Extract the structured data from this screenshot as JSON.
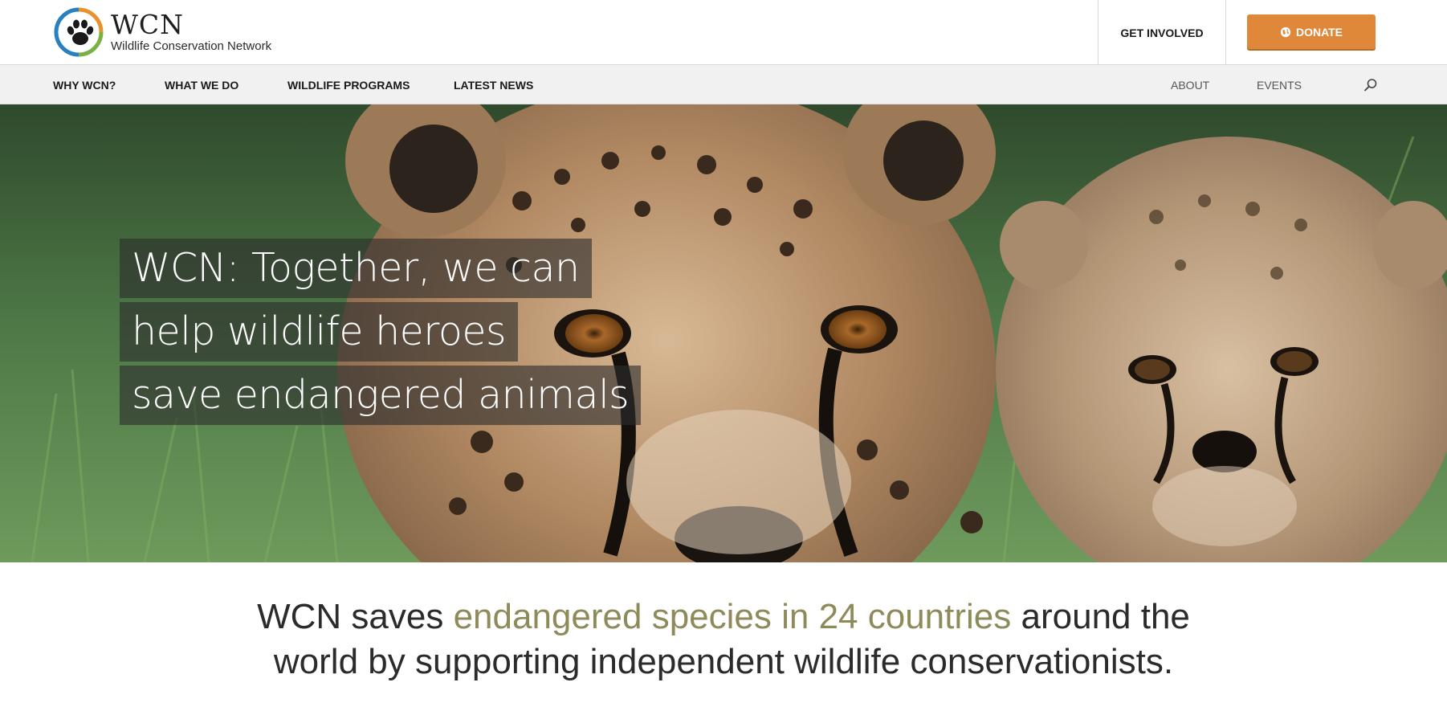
{
  "brand": {
    "name": "WCN",
    "full_name": "Wildlife Conservation Network"
  },
  "header": {
    "get_involved_label": "GET INVOLVED",
    "donate_label": "DONATE"
  },
  "nav": {
    "primary": [
      {
        "label": "WHY WCN?"
      },
      {
        "label": "WHAT WE DO"
      },
      {
        "label": "WILDLIFE PROGRAMS"
      },
      {
        "label": "LATEST NEWS"
      }
    ],
    "secondary": [
      {
        "label": "ABOUT"
      },
      {
        "label": "EVENTS"
      }
    ],
    "search_icon": "search-icon"
  },
  "hero": {
    "headline_lines": [
      "WCN: Together, we can",
      "help wildlife heroes",
      "save endangered animals"
    ],
    "image_subject": "cheetah-and-cub-photo"
  },
  "mission": {
    "part1": "WCN saves ",
    "highlight": "endangered species in 24 countries",
    "part2": " around the",
    "line2": "world by supporting independent wildlife conservationists."
  },
  "colors": {
    "accent_orange": "#e0883a",
    "highlight_olive": "#8e8a5a",
    "logo_blue": "#2a7fc0",
    "logo_green": "#7bb043",
    "logo_orange": "#e8922e"
  }
}
